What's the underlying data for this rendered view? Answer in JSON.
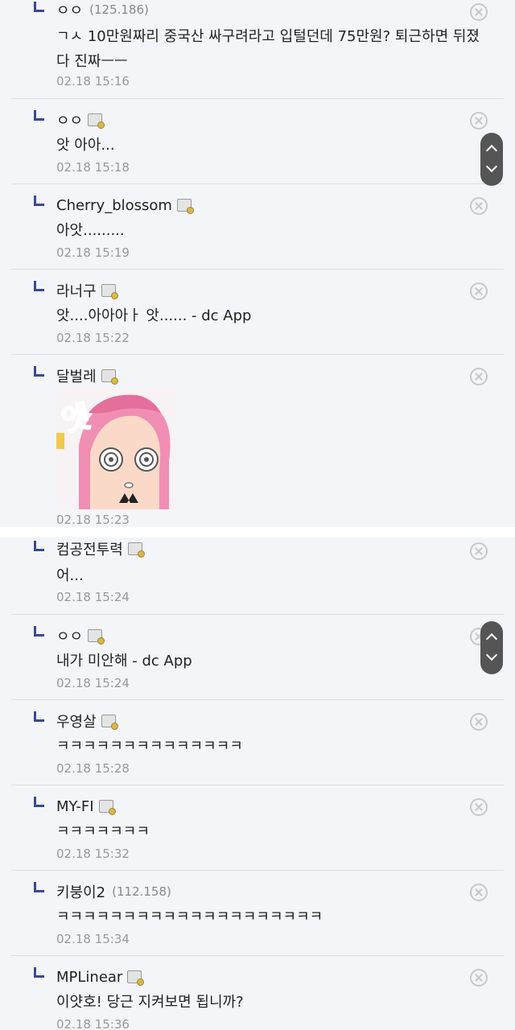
{
  "comments": [
    {
      "nick": "ㅇㅇ",
      "ip": "(125.186)",
      "text": "ㄱㅅ 10만원짜리 중국산 싸구려라고 입털던데 75만원? 퇴근하면 뒤졌다 진짜ㅡㅡ",
      "date": "02.18 15:16"
    },
    {
      "nick": "ㅇㅇ",
      "text": "앗 아아...",
      "date": "02.18 15:18"
    },
    {
      "nick": "Cherry_blossom",
      "text": "아앗.........",
      "date": "02.18 15:19"
    },
    {
      "nick": "라너구",
      "text": "앗....아아아ㅏ 앗...... - dc App",
      "date": "02.18 15:22"
    },
    {
      "nick": "달벌레",
      "sticker_text": "엣",
      "date": "02.18 15:23"
    },
    {
      "nick": "컴공전투력",
      "text": "어...",
      "date": "02.18 15:24"
    },
    {
      "nick": "ㅇㅇ",
      "text": "내가 미안해 - dc App",
      "date": "02.18 15:24"
    },
    {
      "nick": "우영살",
      "text": "ㅋㅋㅋㅋㅋㅋㅋㅋㅋㅋㅋㅋㅋㅋ",
      "date": "02.18 15:28"
    },
    {
      "nick": "MY-FI",
      "text": "ㅋㅋㅋㅋㅋㅋㅋ",
      "date": "02.18 15:32"
    },
    {
      "nick": "키붕이2",
      "ip": "(112.158)",
      "text": "ㅋㅋㅋㅋㅋㅋㅋㅋㅋㅋㅋㅋㅋㅋㅋㅋㅋㅋㅋㅋ",
      "date": "02.18 15:34"
    },
    {
      "nick": "MPLinear",
      "text": "이얏호! 당근 지켜보면 됩니까?",
      "date": "02.18 15:36"
    }
  ],
  "icons": {
    "reply": "reply-arrow-icon",
    "delete": "delete-circle-x-icon",
    "fixed_nick": "fixed-nickname-badge-icon",
    "scroll": "scroll-up-down-icon"
  },
  "colors": {
    "background": "#f3f5f9",
    "reply_arrow": "#3b4a8c",
    "date": "#999999"
  }
}
